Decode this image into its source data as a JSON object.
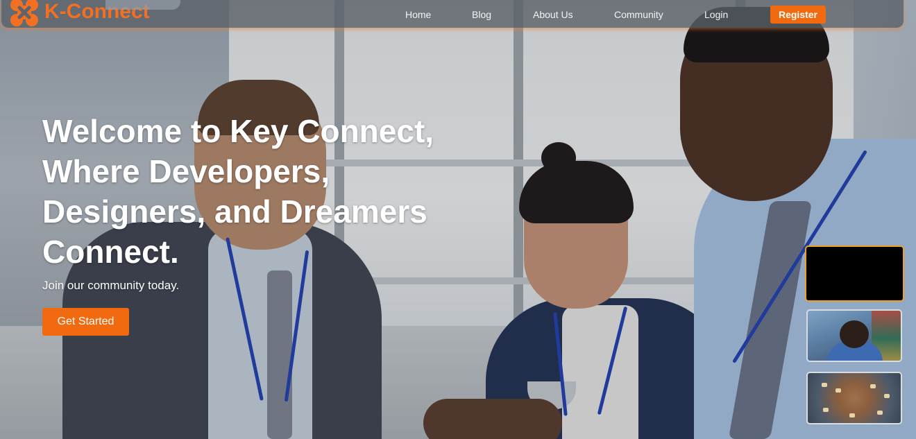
{
  "brand": {
    "name": "K-Connect",
    "accent_color": "#f26a10"
  },
  "nav": {
    "links": [
      {
        "label": "Home"
      },
      {
        "label": "Blog"
      },
      {
        "label": "About Us"
      },
      {
        "label": "Community"
      },
      {
        "label": "Login"
      }
    ],
    "register_label": "Register"
  },
  "hero": {
    "title": "Welcome to Key Connect, Where Developers, Designers, and Dreamers Connect.",
    "subtitle": "Join our community today.",
    "cta_label": "Get Started"
  },
  "thumbnails": [
    {
      "name": "video-thumbnail",
      "active": true
    },
    {
      "name": "community-photo-thumbnail",
      "active": false
    },
    {
      "name": "meeting-photo-thumbnail",
      "active": false
    }
  ]
}
